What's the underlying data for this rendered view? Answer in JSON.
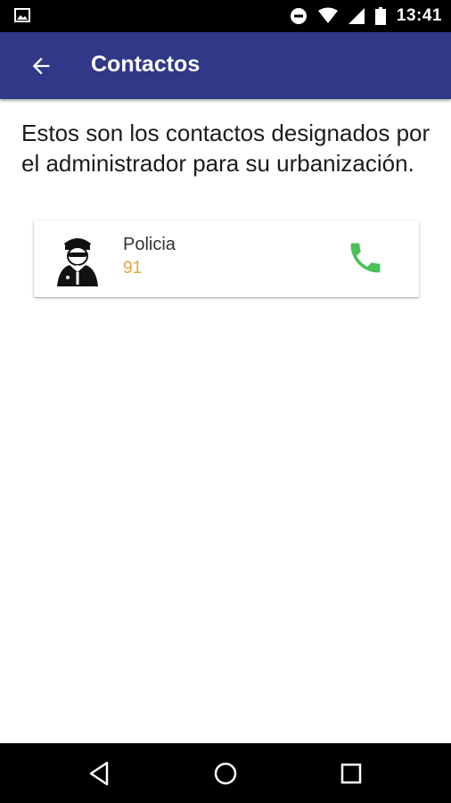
{
  "status_bar": {
    "time": "13:41",
    "icons": [
      "image-notification-icon",
      "do-not-disturb-icon",
      "wifi-icon",
      "signal-icon",
      "battery-icon"
    ]
  },
  "app_bar": {
    "title": "Contactos",
    "back_icon": "arrow-back-icon",
    "color": "#313888"
  },
  "intro": {
    "text": "Estos son los contactos designados por el administrador para su urbanización."
  },
  "contacts": [
    {
      "name": "Policia",
      "number": "91",
      "avatar_icon": "police-officer-icon",
      "call_icon": "phone-icon",
      "number_color": "#e2a53b",
      "call_color": "#4cc15a"
    }
  ],
  "nav_bar": {
    "icons": [
      "nav-back-icon",
      "nav-home-icon",
      "nav-recents-icon"
    ]
  }
}
